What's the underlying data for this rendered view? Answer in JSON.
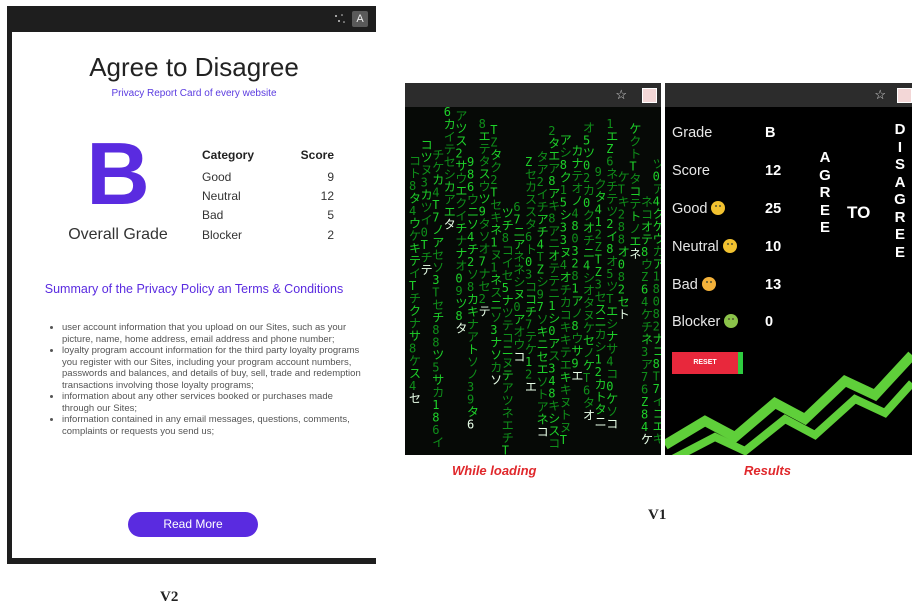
{
  "v2": {
    "ext_icon_letter": "A",
    "title": "Agree to Disagree",
    "subtitle": "Privacy Report Card of every website",
    "grade": "B",
    "grade_label": "Overall Grade",
    "table": {
      "col_category": "Category",
      "col_score": "Score",
      "rows": [
        {
          "category": "Good",
          "score": "9"
        },
        {
          "category": "Neutral",
          "score": "12"
        },
        {
          "category": "Bad",
          "score": "5"
        },
        {
          "category": "Blocker",
          "score": "2"
        }
      ]
    },
    "summary_title": "Summary of the Privacy Policy an Terms & Conditions",
    "policy_items": [
      "user account information that you upload on our Sites, such as your picture, name, home address, email address and phone number;",
      "loyalty program account information for the third party loyalty programs you register with our Sites, including your program account numbers, passwords and balances, and details of buy, sell, trade and redemption transactions involving those loyalty programs;",
      "information about any other services booked or purchases made through our Sites;",
      "information contained in any email messages, questions, comments, complaints or requests you send us;"
    ],
    "read_more": "Read More",
    "caption": "V2"
  },
  "v1": {
    "star_glyph": "☆",
    "results": {
      "rows": [
        {
          "label": "Grade",
          "value": "B",
          "emoji": ""
        },
        {
          "label": "Score",
          "value": "12",
          "emoji": ""
        },
        {
          "label": "Good",
          "value": "25",
          "emoji": "slightly-smiling-face"
        },
        {
          "label": "Neutral",
          "value": "10",
          "emoji": "expressionless-face"
        },
        {
          "label": "Bad",
          "value": "13",
          "emoji": "confused-face"
        },
        {
          "label": "Blocker",
          "value": "0",
          "emoji": "nauseated-face"
        }
      ],
      "reset": "RESET",
      "agree_letters": [
        "A",
        "G",
        "R",
        "E",
        "E"
      ],
      "to_word": "TO",
      "disagree_letters": [
        "D",
        "I",
        "S",
        "A",
        "G",
        "R",
        "E",
        "E"
      ]
    },
    "caption_loading": "While loading",
    "caption_results": "Results",
    "caption": "V1",
    "colors": {
      "accent": "#5a2be0",
      "matrix_green": "#22d12e",
      "reset_red": "#e8283c",
      "zigzag_green": "#5fcf3a"
    }
  }
}
